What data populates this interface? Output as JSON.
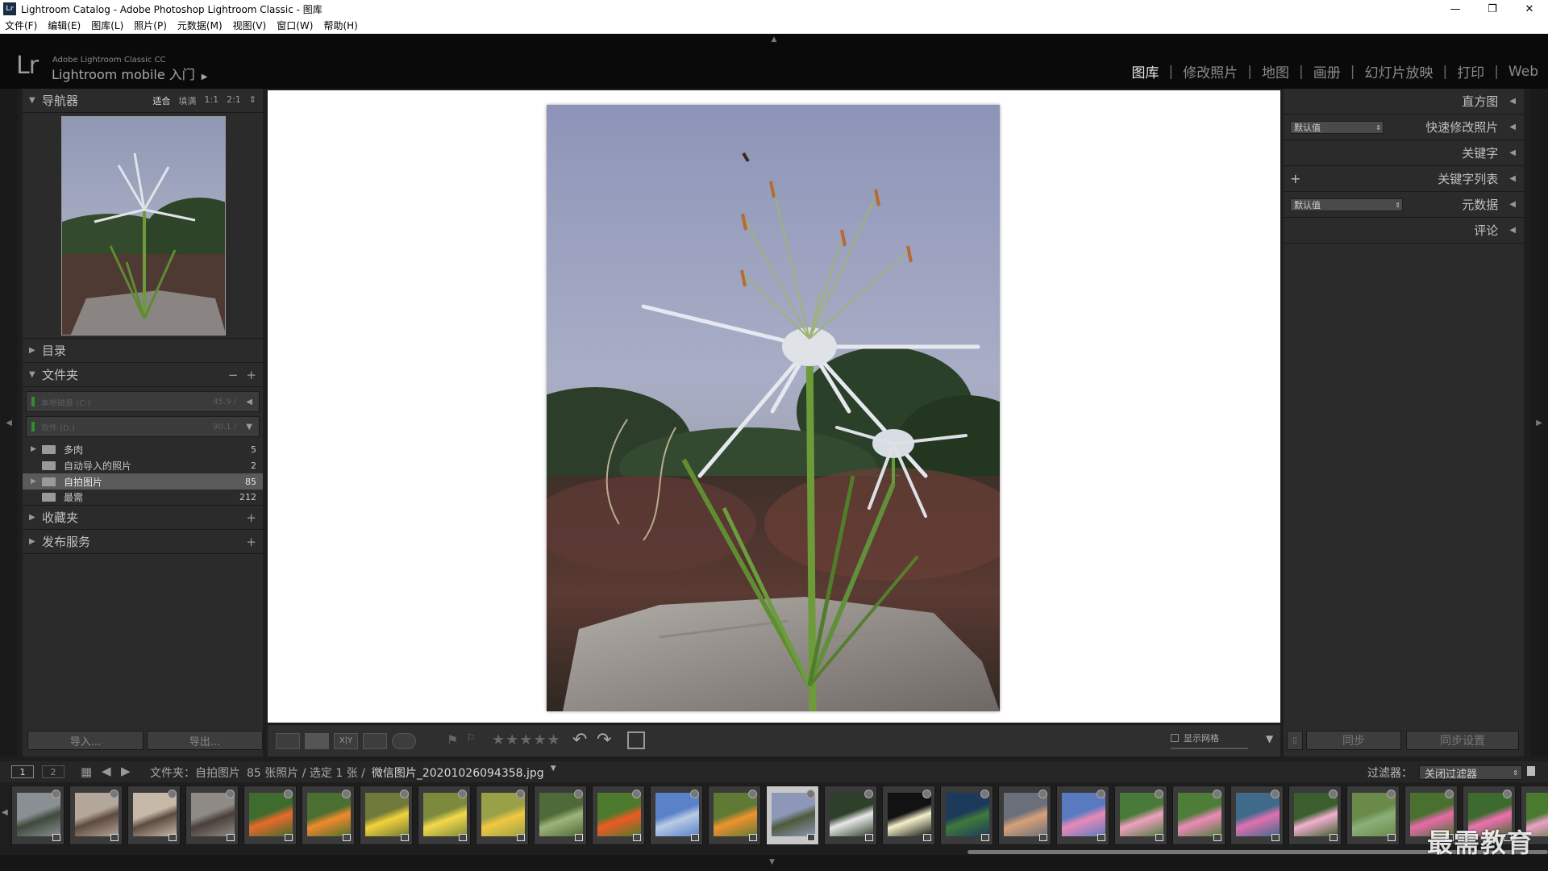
{
  "window": {
    "title": "Lightroom Catalog - Adobe Photoshop Lightroom Classic - 图库"
  },
  "menu": [
    "文件(F)",
    "编辑(E)",
    "图库(L)",
    "照片(P)",
    "元数据(M)",
    "视图(V)",
    "窗口(W)",
    "帮助(H)"
  ],
  "identity": {
    "logo": "Lr",
    "line1": "Adobe Lightroom Classic CC",
    "line2": "Lightroom mobile 入门",
    "arrow": "▶"
  },
  "modules": [
    "图库",
    "修改照片",
    "地图",
    "画册",
    "幻灯片放映",
    "打印",
    "Web"
  ],
  "active_module": "图库",
  "left": {
    "navigator": {
      "title": "导航器",
      "zoom": [
        "适合",
        "填满",
        "1:1",
        "2:1"
      ]
    },
    "catalog": {
      "title": "目录"
    },
    "folders": {
      "title": "文件夹",
      "drives": [
        {
          "label": "本地磁盘 (C:)",
          "capacity": "45.9 /"
        },
        {
          "label": "软件 (D:)",
          "capacity": "90.1 /"
        }
      ],
      "items": [
        {
          "name": "多肉",
          "count": "5",
          "selected": false,
          "expand": true
        },
        {
          "name": "自动导入的照片",
          "count": "2",
          "selected": false,
          "expand": false
        },
        {
          "name": "自拍图片",
          "count": "85",
          "selected": true,
          "expand": true
        },
        {
          "name": "最需",
          "count": "212",
          "selected": false,
          "expand": false
        }
      ]
    },
    "collections": {
      "title": "收藏夹"
    },
    "publish": {
      "title": "发布服务"
    },
    "import_label": "导入...",
    "export_label": "导出..."
  },
  "right": {
    "histogram": "直方图",
    "quick_develop": "快速修改照片",
    "quick_preset": "默认值",
    "keywording": "关键字",
    "keyword_list": "关键字列表",
    "metadata": "元数据",
    "metadata_preset": "默认值",
    "comments": "评论",
    "sync_label": "同步",
    "sync_settings_label": "同步设置"
  },
  "toolbar": {
    "show_grid": "显示网格",
    "stars": "★★★★★"
  },
  "filmbar": {
    "page1": "1",
    "page2": "2",
    "source": "文件夹：自拍图片",
    "count": "85 张照片 / 选定 1 张 /",
    "filename": "微信图片_20201026094358.jpg",
    "filter_label": "过滤器：",
    "filter_value": "关闭过滤器"
  },
  "watermark": "最需教育",
  "thumbs": [
    {
      "c1": "#8a8f94",
      "c2": "#3e4a3a"
    },
    {
      "c1": "#b3a79a",
      "c2": "#5e4a3e"
    },
    {
      "c1": "#c7b9a8",
      "c2": "#5b4b42"
    },
    {
      "c1": "#8e8a86",
      "c2": "#4a3f3a"
    },
    {
      "c1": "#3f6b2e",
      "c2": "#e86a2a"
    },
    {
      "c1": "#4a6f30",
      "c2": "#f08a2c"
    },
    {
      "c1": "#6f7a3a",
      "c2": "#f2d23a"
    },
    {
      "c1": "#7d8a3e",
      "c2": "#f4d84a"
    },
    {
      "c1": "#9aa048",
      "c2": "#f0c840"
    },
    {
      "c1": "#4d6a38",
      "c2": "#9fb47a"
    },
    {
      "c1": "#4d7a2c",
      "c2": "#ee5a24"
    },
    {
      "c1": "#5a82c8",
      "c2": "#b9cbe6"
    },
    {
      "c1": "#5f7a34",
      "c2": "#f0922e"
    },
    {
      "c1": "#8d97b8",
      "c2": "#4d5a3a"
    },
    {
      "c1": "#2e3f2a",
      "c2": "#e8e8e8"
    },
    {
      "c1": "#121212",
      "c2": "#f4f0c8"
    },
    {
      "c1": "#1e3a5a",
      "c2": "#3e7a3a"
    },
    {
      "c1": "#6a6f7a",
      "c2": "#d8a078"
    },
    {
      "c1": "#5a7ac0",
      "c2": "#e88ab8"
    },
    {
      "c1": "#4a7a3a",
      "c2": "#f0a0c0"
    },
    {
      "c1": "#4e7d3a",
      "c2": "#ec8ab8"
    },
    {
      "c1": "#3f6a8a",
      "c2": "#e070b0"
    },
    {
      "c1": "#3a5e2e",
      "c2": "#f4b0d0"
    },
    {
      "c1": "#6a8a4a",
      "c2": "#8ab07a"
    },
    {
      "c1": "#4a7030",
      "c2": "#e86aa8"
    },
    {
      "c1": "#3d6a2e",
      "c2": "#f070b0"
    },
    {
      "c1": "#4a7a30",
      "c2": "#eda0c8"
    }
  ],
  "selected_thumb_index": 13
}
